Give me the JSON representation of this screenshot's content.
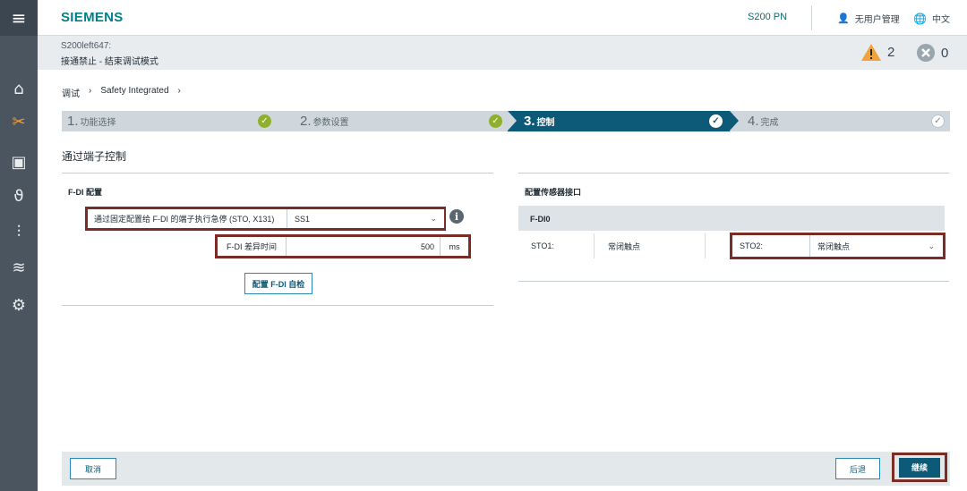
{
  "header": {
    "brand": "SIEMENS",
    "device": "S200 PN",
    "user": "无用户管理",
    "language": "中文"
  },
  "status": {
    "device_id": "S200left647:",
    "message": "接通禁止 - 结束调试模式",
    "warning_count": "2",
    "error_count": "0"
  },
  "breadcrumb": {
    "items": [
      "调试",
      "Safety Integrated"
    ],
    "separator": "›"
  },
  "steps": [
    {
      "num": "1.",
      "label": "功能选择",
      "state": "done"
    },
    {
      "num": "2.",
      "label": "参数设置",
      "state": "done"
    },
    {
      "num": "3.",
      "label": "控制",
      "state": "active"
    },
    {
      "num": "4.",
      "label": "完成",
      "state": "pending"
    }
  ],
  "section_title": "通过端子控制",
  "fdi_config": {
    "title": "F-DI 配置",
    "estop_label": "通过固定配置给 F-DI 的端子执行急停 (STO, X131)",
    "estop_value": "SS1",
    "diff_label": "F-DI 差异时间",
    "diff_value": "500",
    "diff_unit": "ms",
    "selftest_button": "配置 F-DI 自检"
  },
  "sensor": {
    "title": "配置传感器接口",
    "group": "F-DI0",
    "sto1_label": "STO1:",
    "sto1_value": "常闭触点",
    "sto2_label": "STO2:",
    "sto2_value": "常闭触点"
  },
  "footer": {
    "cancel": "取消",
    "back": "后退",
    "continue": "继续"
  },
  "colors": {
    "brand": "#00808a",
    "active_step": "#0d5a78",
    "highlight_border": "#7a2d25",
    "check_green": "#8fb02f",
    "warning": "#f2a23a"
  }
}
